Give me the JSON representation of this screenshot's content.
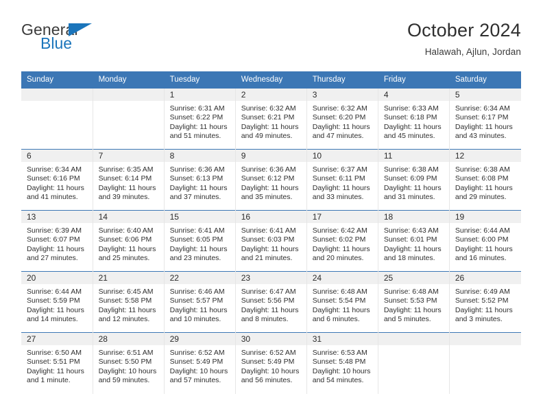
{
  "brand": {
    "name_primary": "General",
    "name_secondary": "Blue",
    "accent_color": "#1b75bb",
    "triangle_icon": "triangle-icon"
  },
  "header": {
    "title": "October 2024",
    "subtitle": "Halawah, Ajlun, Jordan",
    "header_bg_color": "#3c77b5",
    "daynum_band_color": "#f0f0f0"
  },
  "weekday_headers": [
    "Sunday",
    "Monday",
    "Tuesday",
    "Wednesday",
    "Thursday",
    "Friday",
    "Saturday"
  ],
  "labels": {
    "sunrise_prefix": "Sunrise:",
    "sunset_prefix": "Sunset:",
    "daylight_prefix": "Daylight:"
  },
  "weeks": [
    [
      {
        "day": "",
        "sunrise": "",
        "sunset": "",
        "daylight": "",
        "empty": true
      },
      {
        "day": "",
        "sunrise": "",
        "sunset": "",
        "daylight": "",
        "empty": true
      },
      {
        "day": "1",
        "sunrise": "Sunrise: 6:31 AM",
        "sunset": "Sunset: 6:22 PM",
        "daylight": "Daylight: 11 hours and 51 minutes."
      },
      {
        "day": "2",
        "sunrise": "Sunrise: 6:32 AM",
        "sunset": "Sunset: 6:21 PM",
        "daylight": "Daylight: 11 hours and 49 minutes."
      },
      {
        "day": "3",
        "sunrise": "Sunrise: 6:32 AM",
        "sunset": "Sunset: 6:20 PM",
        "daylight": "Daylight: 11 hours and 47 minutes."
      },
      {
        "day": "4",
        "sunrise": "Sunrise: 6:33 AM",
        "sunset": "Sunset: 6:18 PM",
        "daylight": "Daylight: 11 hours and 45 minutes."
      },
      {
        "day": "5",
        "sunrise": "Sunrise: 6:34 AM",
        "sunset": "Sunset: 6:17 PM",
        "daylight": "Daylight: 11 hours and 43 minutes."
      }
    ],
    [
      {
        "day": "6",
        "sunrise": "Sunrise: 6:34 AM",
        "sunset": "Sunset: 6:16 PM",
        "daylight": "Daylight: 11 hours and 41 minutes."
      },
      {
        "day": "7",
        "sunrise": "Sunrise: 6:35 AM",
        "sunset": "Sunset: 6:14 PM",
        "daylight": "Daylight: 11 hours and 39 minutes."
      },
      {
        "day": "8",
        "sunrise": "Sunrise: 6:36 AM",
        "sunset": "Sunset: 6:13 PM",
        "daylight": "Daylight: 11 hours and 37 minutes."
      },
      {
        "day": "9",
        "sunrise": "Sunrise: 6:36 AM",
        "sunset": "Sunset: 6:12 PM",
        "daylight": "Daylight: 11 hours and 35 minutes."
      },
      {
        "day": "10",
        "sunrise": "Sunrise: 6:37 AM",
        "sunset": "Sunset: 6:11 PM",
        "daylight": "Daylight: 11 hours and 33 minutes."
      },
      {
        "day": "11",
        "sunrise": "Sunrise: 6:38 AM",
        "sunset": "Sunset: 6:09 PM",
        "daylight": "Daylight: 11 hours and 31 minutes."
      },
      {
        "day": "12",
        "sunrise": "Sunrise: 6:38 AM",
        "sunset": "Sunset: 6:08 PM",
        "daylight": "Daylight: 11 hours and 29 minutes."
      }
    ],
    [
      {
        "day": "13",
        "sunrise": "Sunrise: 6:39 AM",
        "sunset": "Sunset: 6:07 PM",
        "daylight": "Daylight: 11 hours and 27 minutes."
      },
      {
        "day": "14",
        "sunrise": "Sunrise: 6:40 AM",
        "sunset": "Sunset: 6:06 PM",
        "daylight": "Daylight: 11 hours and 25 minutes."
      },
      {
        "day": "15",
        "sunrise": "Sunrise: 6:41 AM",
        "sunset": "Sunset: 6:05 PM",
        "daylight": "Daylight: 11 hours and 23 minutes."
      },
      {
        "day": "16",
        "sunrise": "Sunrise: 6:41 AM",
        "sunset": "Sunset: 6:03 PM",
        "daylight": "Daylight: 11 hours and 21 minutes."
      },
      {
        "day": "17",
        "sunrise": "Sunrise: 6:42 AM",
        "sunset": "Sunset: 6:02 PM",
        "daylight": "Daylight: 11 hours and 20 minutes."
      },
      {
        "day": "18",
        "sunrise": "Sunrise: 6:43 AM",
        "sunset": "Sunset: 6:01 PM",
        "daylight": "Daylight: 11 hours and 18 minutes."
      },
      {
        "day": "19",
        "sunrise": "Sunrise: 6:44 AM",
        "sunset": "Sunset: 6:00 PM",
        "daylight": "Daylight: 11 hours and 16 minutes."
      }
    ],
    [
      {
        "day": "20",
        "sunrise": "Sunrise: 6:44 AM",
        "sunset": "Sunset: 5:59 PM",
        "daylight": "Daylight: 11 hours and 14 minutes."
      },
      {
        "day": "21",
        "sunrise": "Sunrise: 6:45 AM",
        "sunset": "Sunset: 5:58 PM",
        "daylight": "Daylight: 11 hours and 12 minutes."
      },
      {
        "day": "22",
        "sunrise": "Sunrise: 6:46 AM",
        "sunset": "Sunset: 5:57 PM",
        "daylight": "Daylight: 11 hours and 10 minutes."
      },
      {
        "day": "23",
        "sunrise": "Sunrise: 6:47 AM",
        "sunset": "Sunset: 5:56 PM",
        "daylight": "Daylight: 11 hours and 8 minutes."
      },
      {
        "day": "24",
        "sunrise": "Sunrise: 6:48 AM",
        "sunset": "Sunset: 5:54 PM",
        "daylight": "Daylight: 11 hours and 6 minutes."
      },
      {
        "day": "25",
        "sunrise": "Sunrise: 6:48 AM",
        "sunset": "Sunset: 5:53 PM",
        "daylight": "Daylight: 11 hours and 5 minutes."
      },
      {
        "day": "26",
        "sunrise": "Sunrise: 6:49 AM",
        "sunset": "Sunset: 5:52 PM",
        "daylight": "Daylight: 11 hours and 3 minutes."
      }
    ],
    [
      {
        "day": "27",
        "sunrise": "Sunrise: 6:50 AM",
        "sunset": "Sunset: 5:51 PM",
        "daylight": "Daylight: 11 hours and 1 minute."
      },
      {
        "day": "28",
        "sunrise": "Sunrise: 6:51 AM",
        "sunset": "Sunset: 5:50 PM",
        "daylight": "Daylight: 10 hours and 59 minutes."
      },
      {
        "day": "29",
        "sunrise": "Sunrise: 6:52 AM",
        "sunset": "Sunset: 5:49 PM",
        "daylight": "Daylight: 10 hours and 57 minutes."
      },
      {
        "day": "30",
        "sunrise": "Sunrise: 6:52 AM",
        "sunset": "Sunset: 5:49 PM",
        "daylight": "Daylight: 10 hours and 56 minutes."
      },
      {
        "day": "31",
        "sunrise": "Sunrise: 6:53 AM",
        "sunset": "Sunset: 5:48 PM",
        "daylight": "Daylight: 10 hours and 54 minutes."
      },
      {
        "day": "",
        "sunrise": "",
        "sunset": "",
        "daylight": "",
        "empty": true
      },
      {
        "day": "",
        "sunrise": "",
        "sunset": "",
        "daylight": "",
        "empty": true
      }
    ]
  ]
}
